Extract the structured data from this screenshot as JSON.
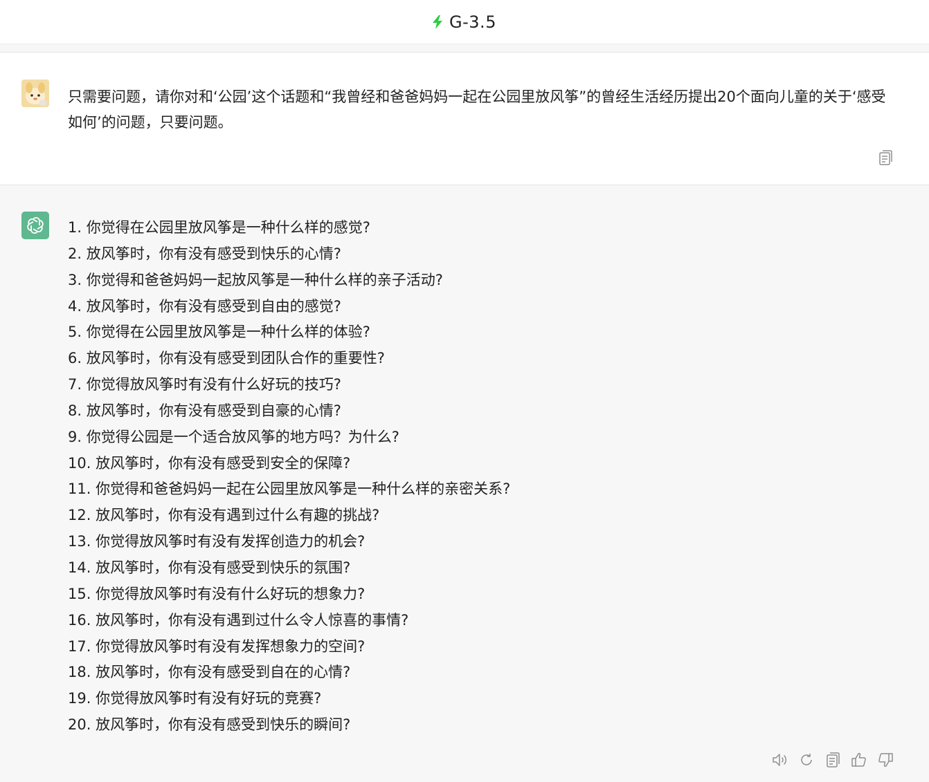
{
  "header": {
    "model_title": "G-3.5",
    "accent_color": "#2ecc40"
  },
  "user_message": {
    "text": "只需要问题，请你对和‘公园’这个话题和“我曾经和爸爸妈妈一起在公园里放风筝”的曾经生活经历提出20个面向儿童的关于‘感受如何’的问题，只要问题。"
  },
  "assistant_message": {
    "items": [
      "1. 你觉得在公园里放风筝是一种什么样的感觉?",
      "2. 放风筝时，你有没有感受到快乐的心情?",
      "3. 你觉得和爸爸妈妈一起放风筝是一种什么样的亲子活动?",
      "4. 放风筝时，你有没有感受到自由的感觉?",
      "5. 你觉得在公园里放风筝是一种什么样的体验?",
      "6. 放风筝时，你有没有感受到团队合作的重要性?",
      "7. 你觉得放风筝时有没有什么好玩的技巧?",
      "8. 放风筝时，你有没有感受到自豪的心情?",
      "9. 你觉得公园是一个适合放风筝的地方吗？为什么?",
      "10. 放风筝时，你有没有感受到安全的保障?",
      "11. 你觉得和爸爸妈妈一起在公园里放风筝是一种什么样的亲密关系?",
      "12. 放风筝时，你有没有遇到过什么有趣的挑战?",
      "13. 你觉得放风筝时有没有发挥创造力的机会?",
      "14. 放风筝时，你有没有感受到快乐的氛围?",
      "15. 你觉得放风筝时有没有什么好玩的想象力?",
      "16. 放风筝时，你有没有遇到过什么令人惊喜的事情?",
      "17. 你觉得放风筝时有没有发挥想象力的空间?",
      "18. 放风筝时，你有没有感受到自在的心情?",
      "19. 你觉得放风筝时有没有好玩的竞赛?",
      "20. 放风筝时，你有没有感受到快乐的瞬间?"
    ],
    "avatar_color": "#5fb88f"
  },
  "icons": {
    "model": "lightning-bolt-icon",
    "user_copy": "copy-icon",
    "actions": [
      "speaker-icon",
      "regenerate-icon",
      "copy-icon",
      "thumbs-up-icon",
      "thumbs-down-icon"
    ]
  }
}
